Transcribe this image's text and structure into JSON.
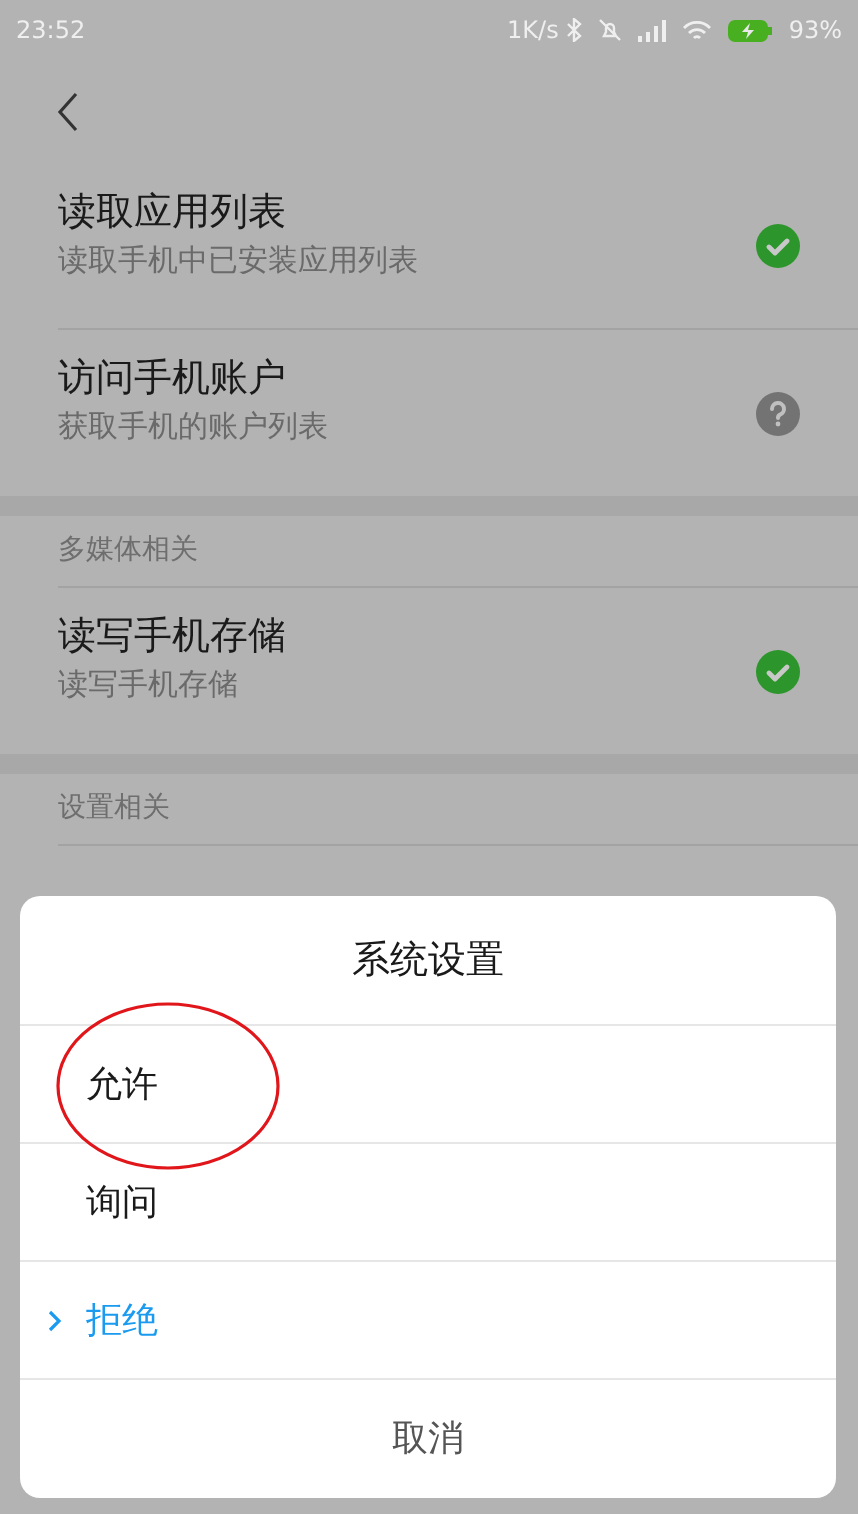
{
  "status_bar": {
    "time": "23:52",
    "net_speed": "1K/s",
    "battery": "93%"
  },
  "sections": [
    {
      "items": [
        {
          "title": "读取应用列表",
          "subtitle": "读取手机中已安装应用列表",
          "kind": "allowed"
        },
        {
          "title": "访问手机账户",
          "subtitle": "获取手机的账户列表",
          "kind": "ask"
        }
      ]
    },
    {
      "header": "多媒体相关",
      "items": [
        {
          "title": "读写手机存储",
          "subtitle": "读写手机存储",
          "kind": "allowed"
        }
      ]
    },
    {
      "header": "设置相关"
    }
  ],
  "dialog": {
    "title": "系统设置",
    "options": [
      {
        "label": "允许",
        "selected": false
      },
      {
        "label": "询问",
        "selected": false
      },
      {
        "label": "拒绝",
        "selected": true
      }
    ],
    "cancel": "取消"
  }
}
